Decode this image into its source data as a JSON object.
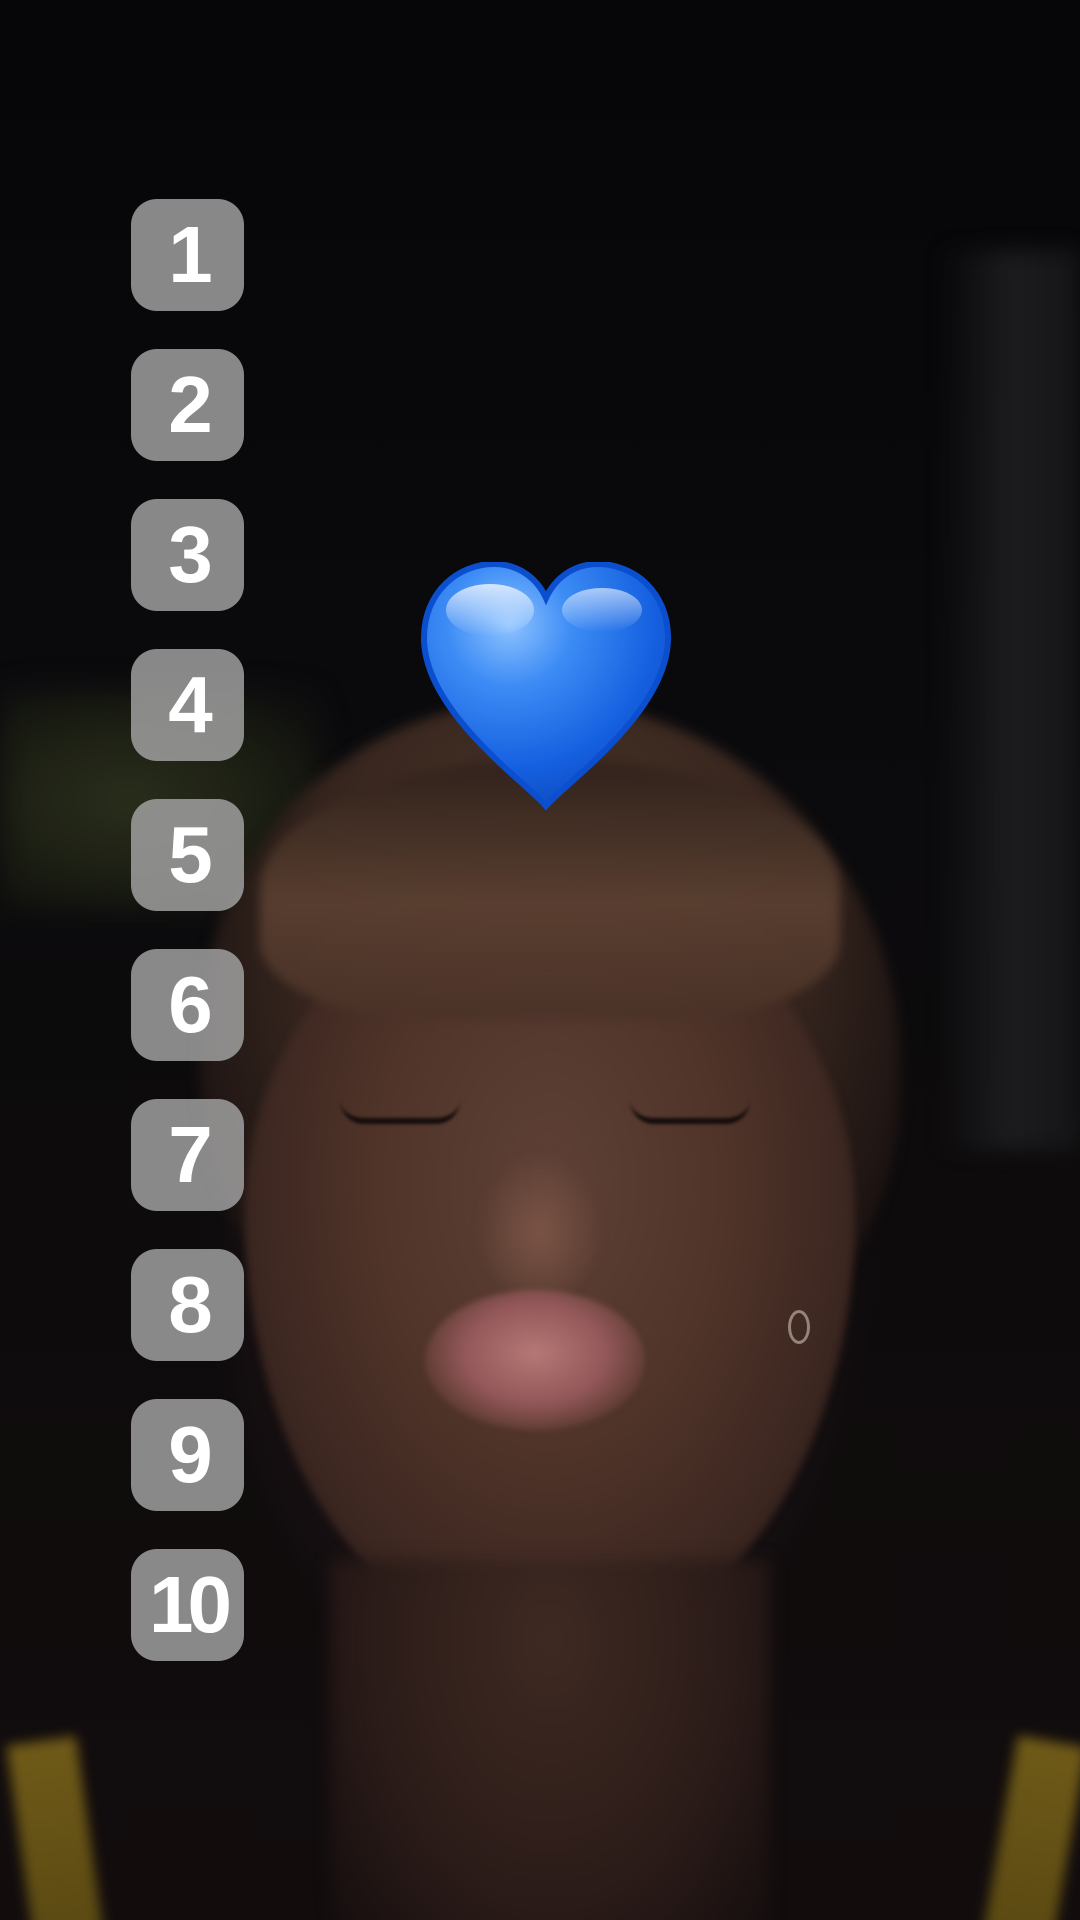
{
  "overlay": {
    "numbers": [
      "1",
      "2",
      "3",
      "4",
      "5",
      "6",
      "7",
      "8",
      "9",
      "10"
    ],
    "tile_color": "#a5a5a5",
    "text_color": "#ffffff"
  },
  "sticker": {
    "icon": "blue-heart-icon",
    "color": "#1f6fe6"
  }
}
